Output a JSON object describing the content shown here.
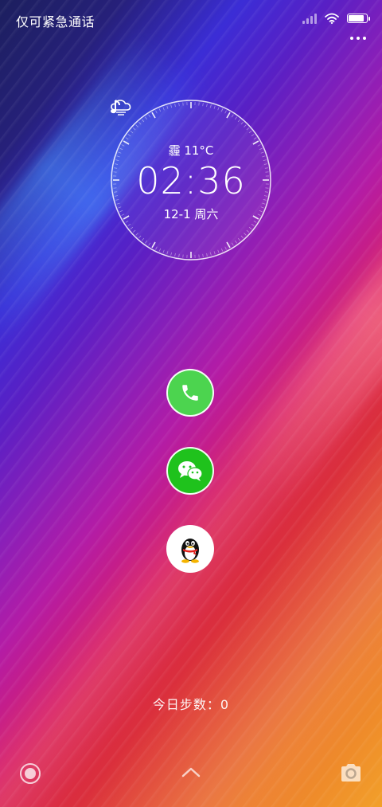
{
  "status_bar": {
    "carrier_text": "仅可紧急通话",
    "signal_icon": "signal-icon",
    "wifi_icon": "wifi-icon",
    "battery_icon": "battery-icon",
    "battery_level": 0.9
  },
  "menu": {
    "more_icon": "more-dots-icon"
  },
  "clock": {
    "weather_icon": "cloud-rain-icon",
    "weather": "霾 11°C",
    "time": "02:36",
    "date": "12-1 周六",
    "music_icon": "music-note-icon"
  },
  "shortcuts": [
    {
      "name": "phone",
      "icon": "phone-icon",
      "color": "#4cd44f"
    },
    {
      "name": "wechat",
      "icon": "wechat-icon",
      "color": "#1fc21c"
    },
    {
      "name": "qq",
      "icon": "qq-penguin-icon",
      "color": "#ffffff"
    }
  ],
  "steps": {
    "label": "今日步数：0"
  },
  "bottom_bar": {
    "left_icon": "assistant-icon",
    "center_icon": "chevron-up-icon",
    "right_icon": "camera-icon"
  }
}
